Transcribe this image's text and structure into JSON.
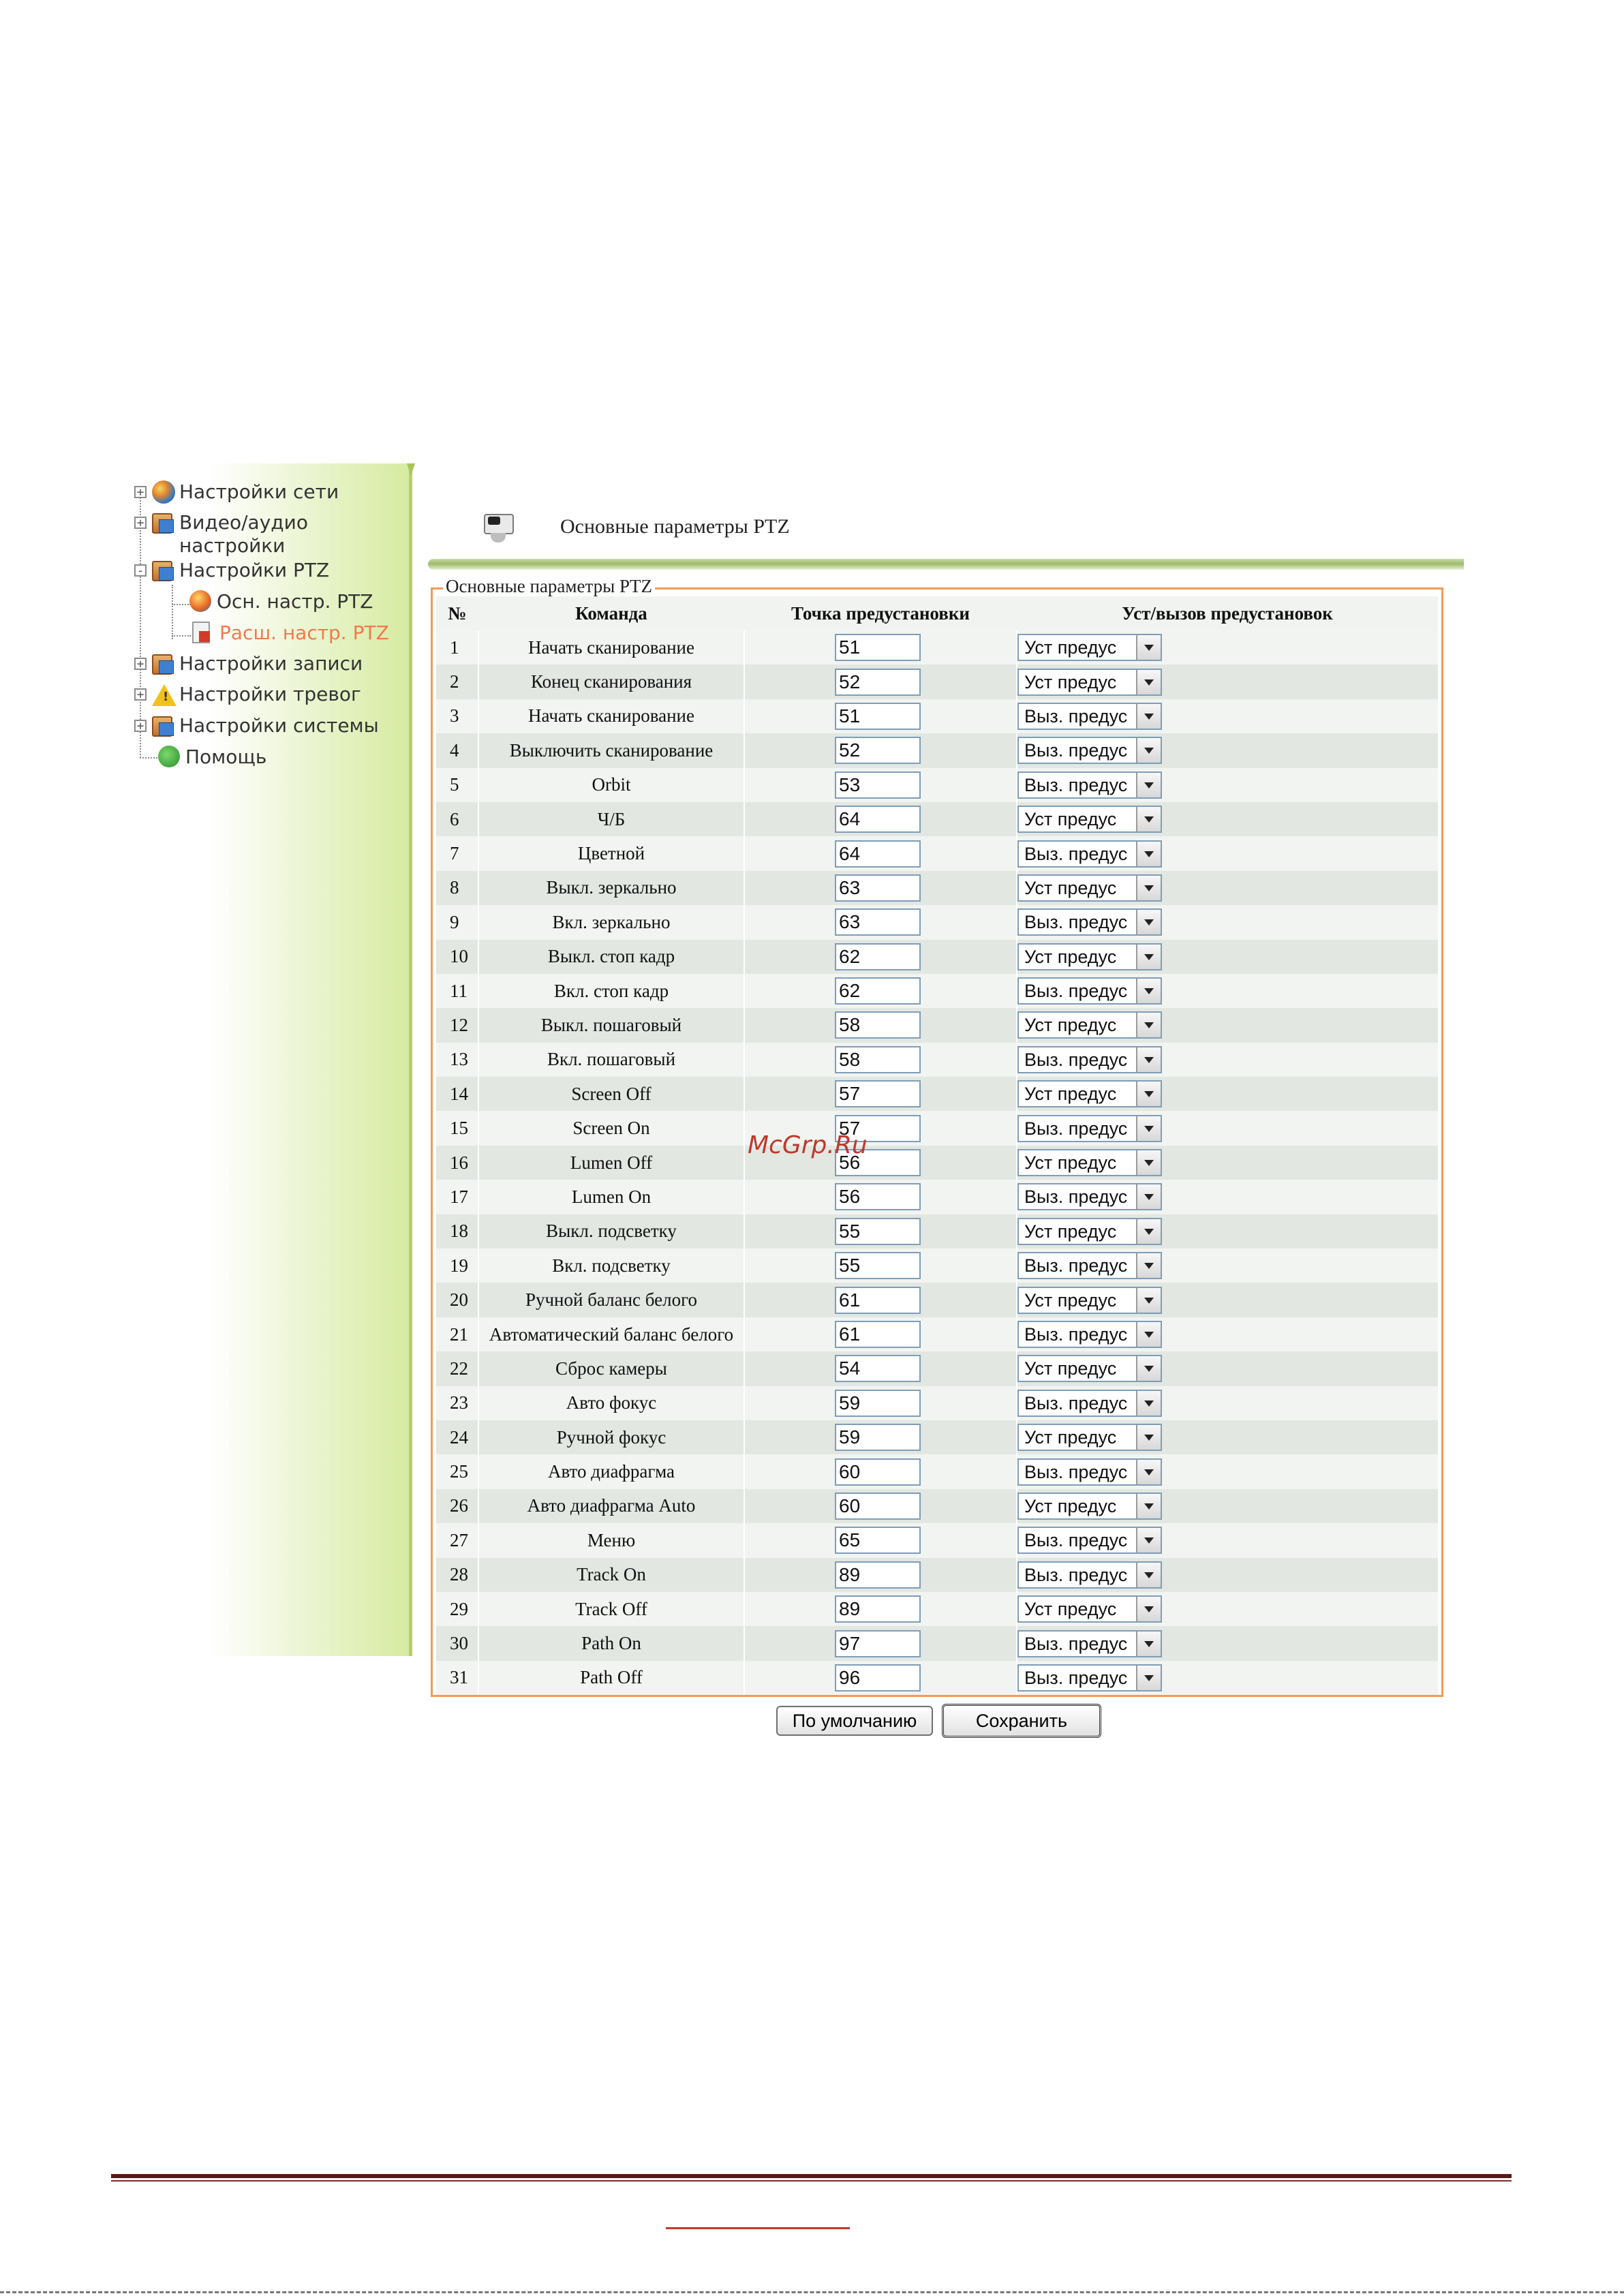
{
  "sidebar": {
    "items": [
      {
        "label": "Настройки сети",
        "icon": "globe-icon",
        "expander": "+"
      },
      {
        "label": "Видео/аудио настройки",
        "icon": "folder-icon",
        "expander": "+"
      },
      {
        "label": "Настройки PTZ",
        "icon": "folder-icon",
        "expander": "-"
      },
      {
        "label": "Осн. настр. PTZ",
        "icon": "ptz-icon",
        "child": true
      },
      {
        "label": "Расш. настр. PTZ",
        "icon": "document-icon",
        "child": true,
        "active": true
      },
      {
        "label": "Настройки записи",
        "icon": "folder-icon",
        "expander": "+"
      },
      {
        "label": "Настройки тревог",
        "icon": "warning-icon",
        "expander": "+"
      },
      {
        "label": "Настройки системы",
        "icon": "folder-icon",
        "expander": "+"
      },
      {
        "label": "Помощь",
        "icon": "help-icon"
      }
    ],
    "video_label_line1": "Видео/аудио",
    "video_label_line2": "настройки"
  },
  "header": {
    "title": "Основные параметры PTZ",
    "icon": "camera-icon"
  },
  "fieldset": {
    "legend": "Основные параметры PTZ"
  },
  "table": {
    "headers": [
      "№",
      "Команда",
      "Точка предустановки",
      "Уст/вызов предустановок"
    ],
    "rows": [
      {
        "n": "1",
        "cmd": "Начать сканирование",
        "preset": "51",
        "action": "Уст предус"
      },
      {
        "n": "2",
        "cmd": "Конец сканирования",
        "preset": "52",
        "action": "Уст предус"
      },
      {
        "n": "3",
        "cmd": "Начать сканирование",
        "preset": "51",
        "action": "Выз. предус"
      },
      {
        "n": "4",
        "cmd": "Выключить сканирование",
        "preset": "52",
        "action": "Выз. предус"
      },
      {
        "n": "5",
        "cmd": "Orbit",
        "preset": "53",
        "action": "Выз. предус"
      },
      {
        "n": "6",
        "cmd": "Ч/Б",
        "preset": "64",
        "action": "Уст предус"
      },
      {
        "n": "7",
        "cmd": "Цветной",
        "preset": "64",
        "action": "Выз. предус"
      },
      {
        "n": "8",
        "cmd": "Выкл. зеркально",
        "preset": "63",
        "action": "Уст предус"
      },
      {
        "n": "9",
        "cmd": "Вкл. зеркально",
        "preset": "63",
        "action": "Выз. предус"
      },
      {
        "n": "10",
        "cmd": "Выкл. стоп кадр",
        "preset": "62",
        "action": "Уст предус"
      },
      {
        "n": "11",
        "cmd": "Вкл. стоп кадр",
        "preset": "62",
        "action": "Выз. предус"
      },
      {
        "n": "12",
        "cmd": "Выкл. пошаговый",
        "preset": "58",
        "action": "Уст предус"
      },
      {
        "n": "13",
        "cmd": "Вкл. пошаговый",
        "preset": "58",
        "action": "Выз. предус"
      },
      {
        "n": "14",
        "cmd": "Screen Off",
        "preset": "57",
        "action": "Уст предус"
      },
      {
        "n": "15",
        "cmd": "Screen On",
        "preset": "57",
        "action": "Выз. предус"
      },
      {
        "n": "16",
        "cmd": "Lumen Off",
        "preset": "56",
        "action": "Уст предус"
      },
      {
        "n": "17",
        "cmd": "Lumen On",
        "preset": "56",
        "action": "Выз. предус"
      },
      {
        "n": "18",
        "cmd": "Выкл. подсветку",
        "preset": "55",
        "action": "Уст предус"
      },
      {
        "n": "19",
        "cmd": "Вкл. подсветку",
        "preset": "55",
        "action": "Выз. предус"
      },
      {
        "n": "20",
        "cmd": "Ручной баланс белого",
        "preset": "61",
        "action": "Уст предус"
      },
      {
        "n": "21",
        "cmd": "Автоматический баланс белого",
        "preset": "61",
        "action": "Выз. предус"
      },
      {
        "n": "22",
        "cmd": "Сброс камеры",
        "preset": "54",
        "action": "Уст предус"
      },
      {
        "n": "23",
        "cmd": "Авто фокус",
        "preset": "59",
        "action": "Выз. предус"
      },
      {
        "n": "24",
        "cmd": "Ручной фокус",
        "preset": "59",
        "action": "Уст предус"
      },
      {
        "n": "25",
        "cmd": "Авто диафрагма",
        "preset": "60",
        "action": "Выз. предус"
      },
      {
        "n": "26",
        "cmd": "Авто диафрагма Auto",
        "preset": "60",
        "action": "Уст предус"
      },
      {
        "n": "27",
        "cmd": "Меню",
        "preset": "65",
        "action": "Выз. предус"
      },
      {
        "n": "28",
        "cmd": "Track On",
        "preset": "89",
        "action": "Выз. предус"
      },
      {
        "n": "29",
        "cmd": "Track Off",
        "preset": "89",
        "action": "Уст предус"
      },
      {
        "n": "30",
        "cmd": "Path On",
        "preset": "97",
        "action": "Выз. предус"
      },
      {
        "n": "31",
        "cmd": "Path Off",
        "preset": "96",
        "action": "Выз. предус"
      }
    ]
  },
  "buttons": {
    "default_label": "По умолчанию",
    "save_label": "Сохранить"
  },
  "watermark": "McGrp.Ru",
  "colors": {
    "fieldset_border": "#f29a5a",
    "active_tree_item": "#f07a4a",
    "sidebar_accent": "#d6eba0",
    "footer_rule": "#5e1717",
    "watermark": "#c0392b"
  }
}
